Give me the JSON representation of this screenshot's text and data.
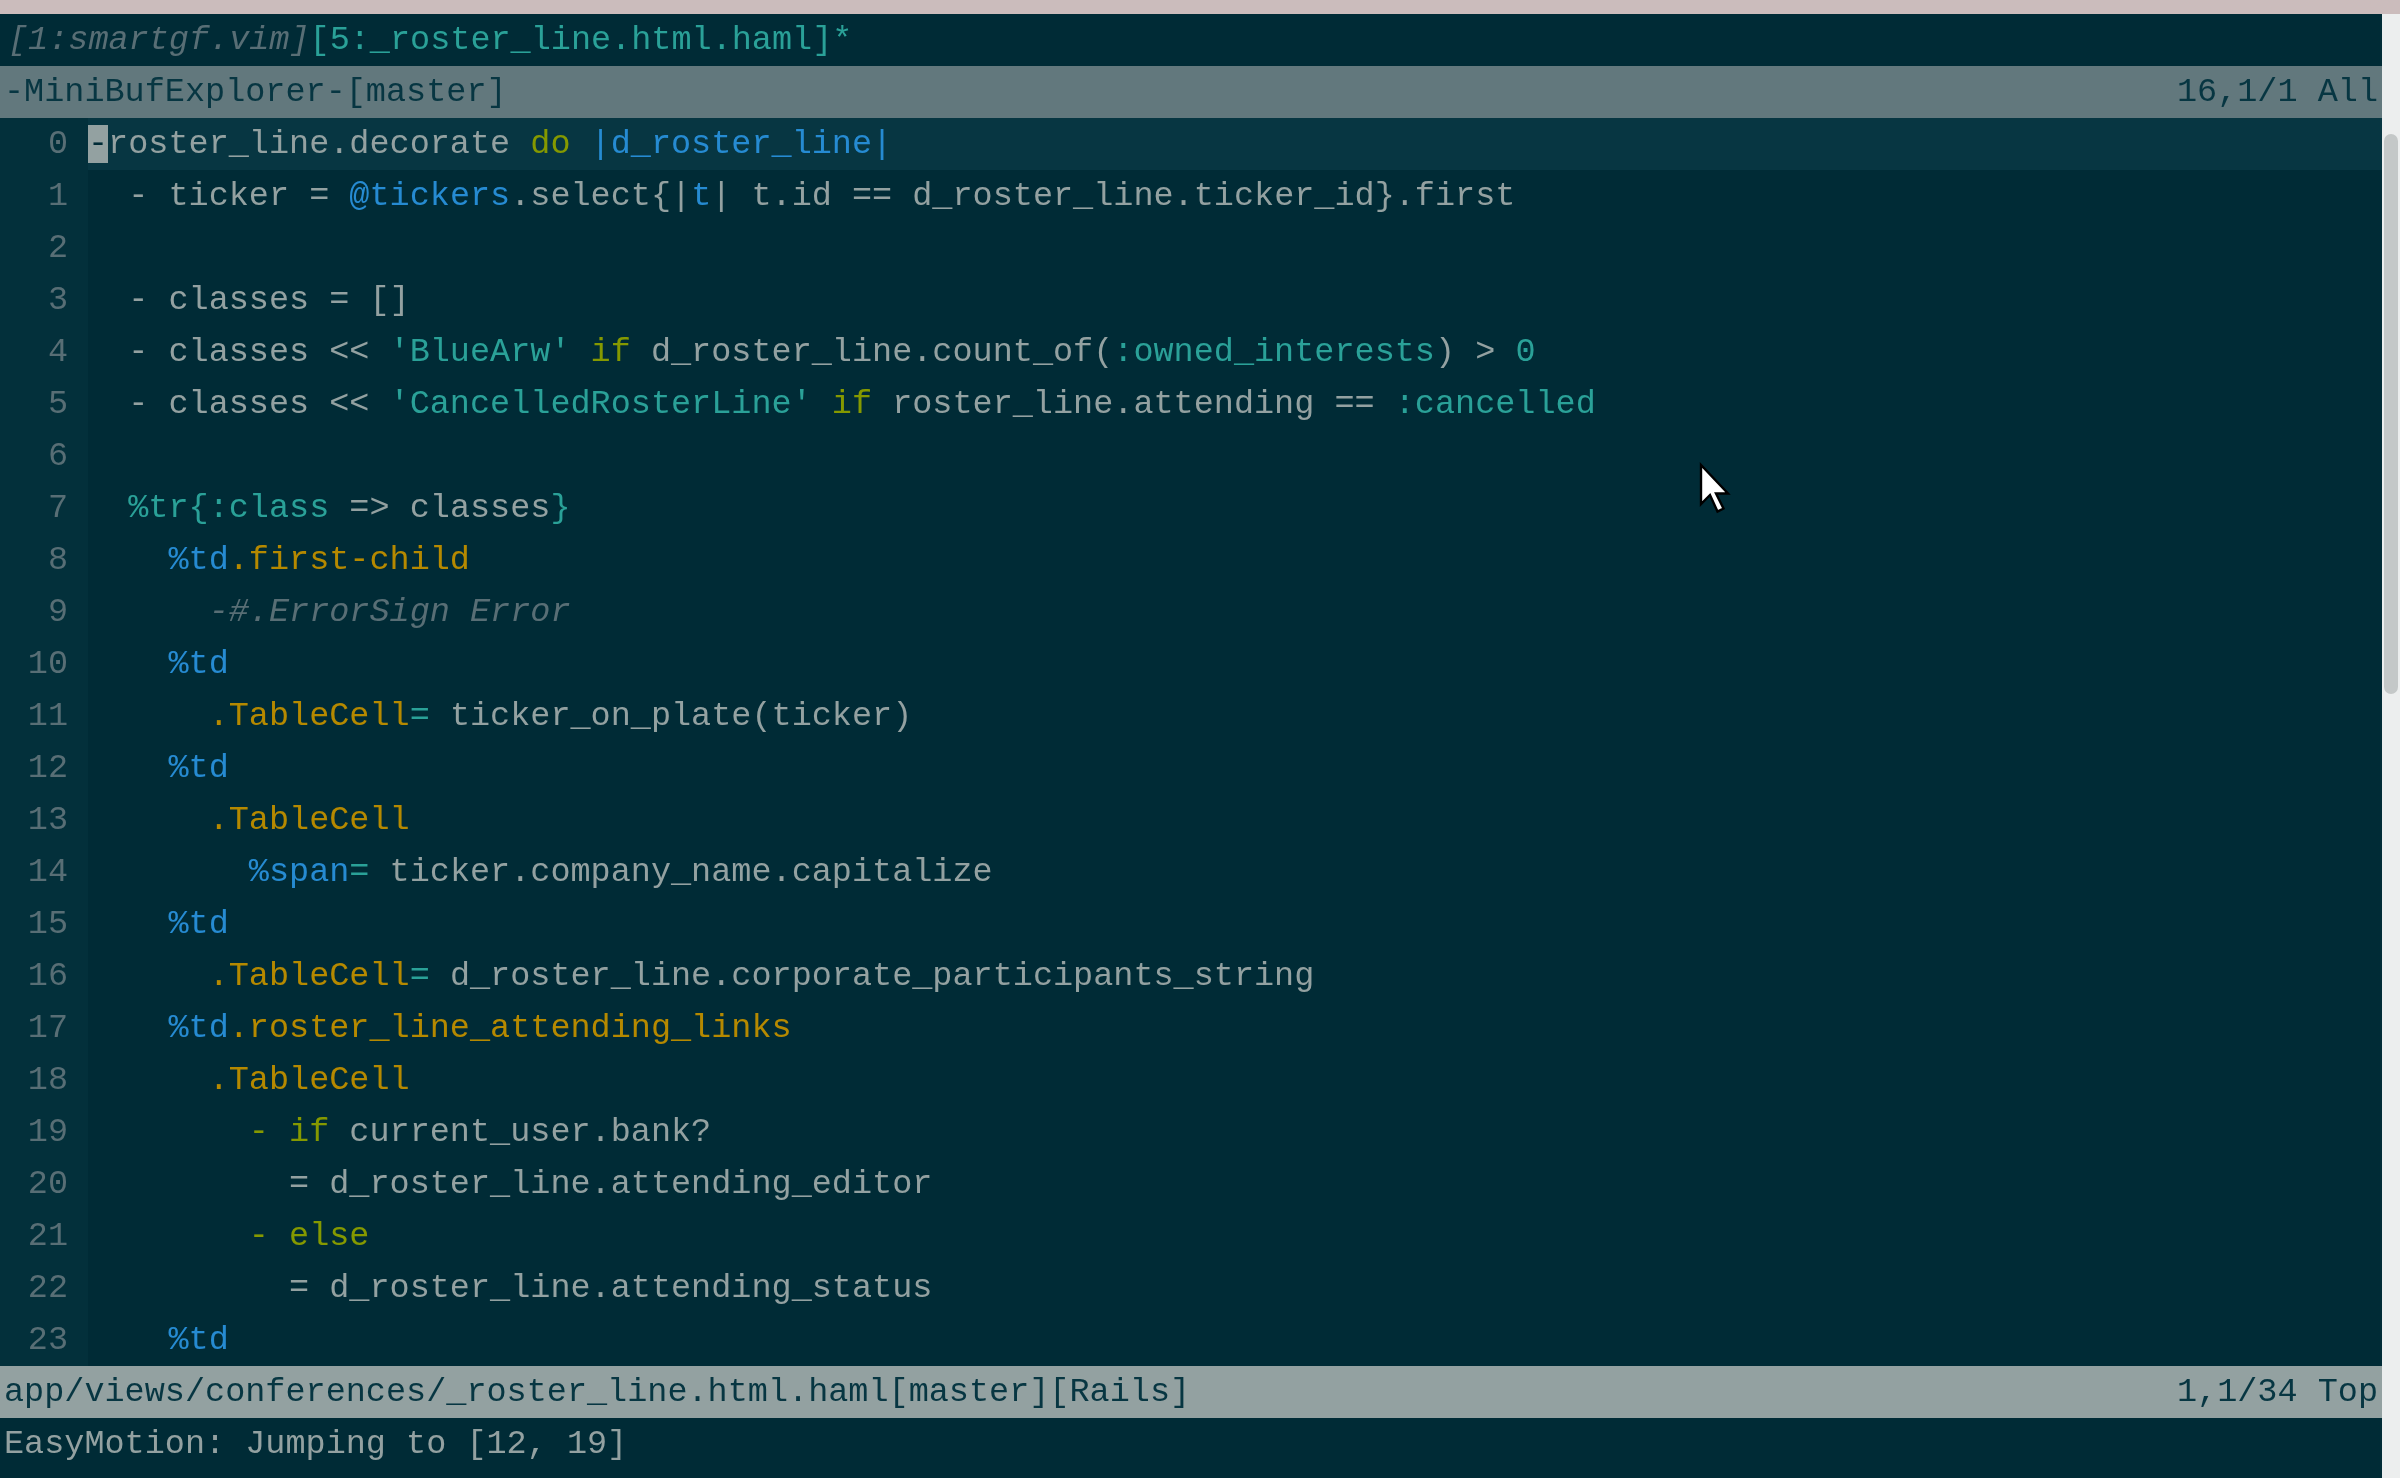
{
  "tabline": [
    {
      "label": "[1:smartgf.vim]",
      "selected": false
    },
    {
      "label": "[5:_roster_line.html.haml]*",
      "selected": true
    }
  ],
  "minibuf_status": {
    "left": "-MiniBufExplorer-[master]",
    "right": "16,1/1 All"
  },
  "lines": [
    {
      "number": "0",
      "current": true,
      "tokens": [
        {
          "text": "-",
          "kind": "cursor"
        },
        {
          "text": "roster_line.decorate ",
          "kind": "plain"
        },
        {
          "text": "do",
          "kind": "keyword"
        },
        {
          "text": " |d_roster_line|",
          "kind": "variable"
        }
      ]
    },
    {
      "number": "1",
      "current": false,
      "tokens": [
        {
          "text": "  - ticker = ",
          "kind": "plain"
        },
        {
          "text": "@tickers",
          "kind": "variable"
        },
        {
          "text": ".select{|",
          "kind": "plain"
        },
        {
          "text": "t",
          "kind": "variable"
        },
        {
          "text": "| t.id == d_roster_line.ticker_id}.first",
          "kind": "plain"
        }
      ]
    },
    {
      "number": "2",
      "current": false
    },
    {
      "number": "3",
      "current": false,
      "tokens": [
        {
          "text": "  - classes = []",
          "kind": "plain"
        }
      ]
    },
    {
      "number": "4",
      "current": false,
      "tokens": [
        {
          "text": "  - classes << ",
          "kind": "plain"
        },
        {
          "text": "'BlueArw'",
          "kind": "string"
        },
        {
          "text": " if",
          "kind": "keyword"
        },
        {
          "text": " d_roster_line.count_of(",
          "kind": "plain"
        },
        {
          "text": ":owned_interests",
          "kind": "symbol"
        },
        {
          "text": ") > ",
          "kind": "plain"
        },
        {
          "text": "0",
          "kind": "symbol"
        }
      ]
    },
    {
      "number": "5",
      "current": false,
      "tokens": [
        {
          "text": "  - classes << ",
          "kind": "plain"
        },
        {
          "text": "'CancelledRosterLine'",
          "kind": "string"
        },
        {
          "text": " if",
          "kind": "keyword"
        },
        {
          "text": " roster_line.attending == ",
          "kind": "plain"
        },
        {
          "text": ":cancelled",
          "kind": "symbol"
        }
      ]
    },
    {
      "number": "6",
      "current": false
    },
    {
      "number": "7",
      "current": false,
      "tokens": [
        {
          "text": "  %tr{",
          "kind": "symbol"
        },
        {
          "text": ":class",
          "kind": "symbol"
        },
        {
          "text": " => classes",
          "kind": "plain"
        },
        {
          "text": "}",
          "kind": "symbol"
        }
      ]
    },
    {
      "number": "8",
      "current": false,
      "tokens": [
        {
          "text": "    %td",
          "kind": "tag"
        },
        {
          "text": ".first-child",
          "kind": "class"
        }
      ]
    },
    {
      "number": "9",
      "current": false,
      "tokens": [
        {
          "text": "      -#.ErrorSign Error",
          "kind": "comment"
        }
      ]
    },
    {
      "number": "10",
      "current": false,
      "tokens": [
        {
          "text": "    %td",
          "kind": "tag"
        }
      ]
    },
    {
      "number": "11",
      "current": false,
      "tokens": [
        {
          "text": "      .TableCell",
          "kind": "class"
        },
        {
          "text": "=",
          "kind": "symbol"
        },
        {
          "text": " ticker_on_plate(ticker)",
          "kind": "plain"
        }
      ]
    },
    {
      "number": "12",
      "current": false,
      "tokens": [
        {
          "text": "    %td",
          "kind": "tag"
        }
      ]
    },
    {
      "number": "13",
      "current": false,
      "tokens": [
        {
          "text": "      .TableCell",
          "kind": "class"
        }
      ]
    },
    {
      "number": "14",
      "current": false,
      "tokens": [
        {
          "text": "        %span",
          "kind": "tag"
        },
        {
          "text": "=",
          "kind": "symbol"
        },
        {
          "text": " ticker.company_name.capitalize",
          "kind": "plain"
        }
      ]
    },
    {
      "number": "15",
      "current": false,
      "tokens": [
        {
          "text": "    %td",
          "kind": "tag"
        }
      ]
    },
    {
      "number": "16",
      "current": false,
      "tokens": [
        {
          "text": "      .TableCell",
          "kind": "class"
        },
        {
          "text": "=",
          "kind": "symbol"
        },
        {
          "text": " d_roster_line.corporate_participants_string",
          "kind": "plain"
        }
      ]
    },
    {
      "number": "17",
      "current": false,
      "tokens": [
        {
          "text": "    %td",
          "kind": "tag"
        },
        {
          "text": ".roster_line_attending_links",
          "kind": "class"
        }
      ]
    },
    {
      "number": "18",
      "current": false,
      "tokens": [
        {
          "text": "      .TableCell",
          "kind": "class"
        }
      ]
    },
    {
      "number": "19",
      "current": false,
      "tokens": [
        {
          "text": "        - if",
          "kind": "keyword"
        },
        {
          "text": " current_user.bank?",
          "kind": "plain"
        }
      ]
    },
    {
      "number": "20",
      "current": false,
      "tokens": [
        {
          "text": "          = d_roster_line.attending_editor",
          "kind": "plain"
        }
      ]
    },
    {
      "number": "21",
      "current": false,
      "tokens": [
        {
          "text": "        - else",
          "kind": "keyword"
        }
      ]
    },
    {
      "number": "22",
      "current": false,
      "tokens": [
        {
          "text": "          = d_roster_line.attending_status",
          "kind": "plain"
        }
      ]
    },
    {
      "number": "23",
      "current": false,
      "tokens": [
        {
          "text": "    %td",
          "kind": "tag"
        }
      ]
    }
  ],
  "status_line": {
    "left": "app/views/conferences/_roster_line.html.haml[master][Rails]",
    "right": "1,1/34 Top"
  },
  "command_line": "EasyMotion: Jumping to [12, 19]"
}
